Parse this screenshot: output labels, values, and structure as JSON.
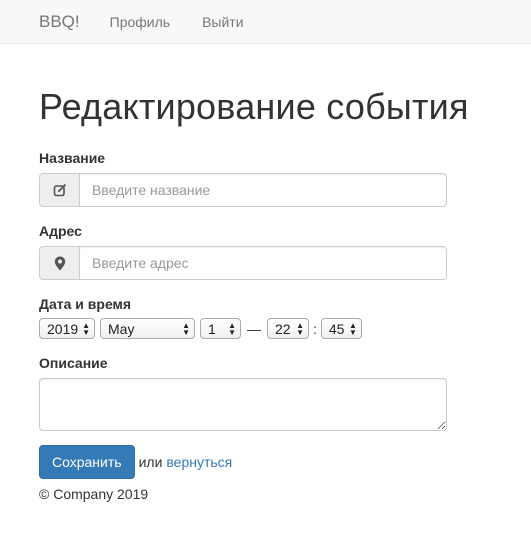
{
  "navbar": {
    "brand": "BBQ!",
    "links": [
      "Профиль",
      "Выйти"
    ]
  },
  "page": {
    "title": "Редактирование события"
  },
  "form": {
    "name_label": "Название",
    "name_placeholder": "Введите название",
    "address_label": "Адрес",
    "address_placeholder": "Введите адрес",
    "datetime_label": "Дата и время",
    "year": "2019",
    "month": "May",
    "day": "1",
    "dash": "—",
    "hour": "22",
    "colon": ":",
    "minute": "45",
    "description_label": "Описание",
    "submit_label": "Сохранить",
    "or_text": "или",
    "back_link": "вернуться"
  },
  "footer": {
    "copyright": "© Company 2019"
  },
  "icons": {
    "name": "edit-icon",
    "address": "map-marker-icon"
  }
}
